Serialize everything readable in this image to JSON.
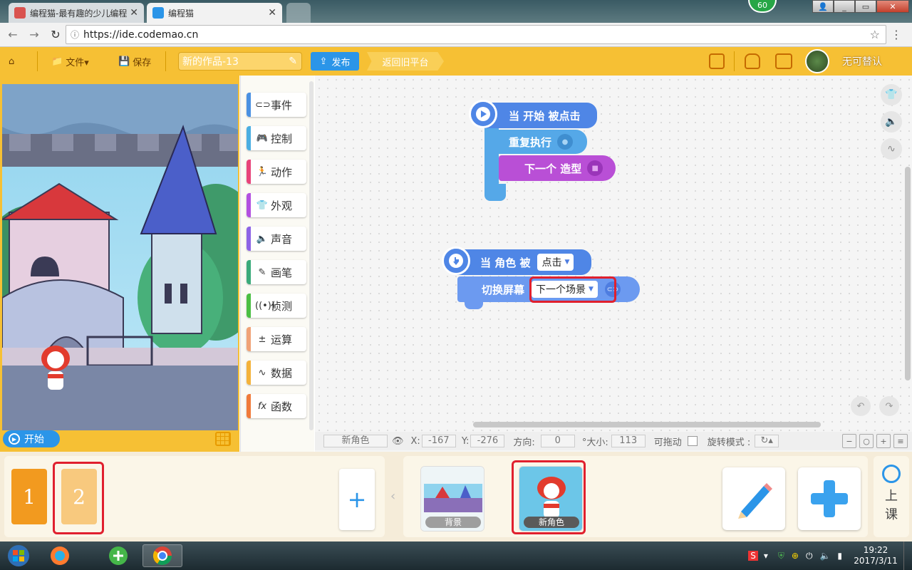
{
  "browser": {
    "tabs": [
      {
        "title": "编程猫-最有趣的少儿编程",
        "icon_color": "#d9534f"
      },
      {
        "title": "编程猫",
        "icon_color": "#2b95e8"
      },
      {
        "title": "",
        "icon_color": "#9fb0b5"
      }
    ],
    "url": "https://ide.codemao.cn",
    "badge": "60"
  },
  "toolbar": {
    "file_label": "文件▾",
    "save_label": "保存",
    "project_title": "新的作品-13",
    "publish_label": "发布",
    "old_platform_label": "返回旧平台",
    "username": "无可替认"
  },
  "stage": {
    "start_label": "开始"
  },
  "categories": [
    {
      "label": "事件",
      "color": "#4a90e2",
      "icon": "toggle-icon"
    },
    {
      "label": "控制",
      "color": "#4aaee2",
      "icon": "gamepad-icon"
    },
    {
      "label": "动作",
      "color": "#e8437a",
      "icon": "running-icon"
    },
    {
      "label": "外观",
      "color": "#b24fe0",
      "icon": "shirt-icon"
    },
    {
      "label": "声音",
      "color": "#8c63e6",
      "icon": "speaker-icon"
    },
    {
      "label": "画笔",
      "color": "#3aaa7a",
      "icon": "pen-icon"
    },
    {
      "label": "侦测",
      "color": "#4bbf43",
      "icon": "sensor-icon"
    },
    {
      "label": "运算",
      "color": "#f0a277",
      "icon": "calc-icon"
    },
    {
      "label": "数据",
      "color": "#f4b23a",
      "icon": "chart-icon"
    },
    {
      "label": "函数",
      "color": "#f07a3a",
      "icon": "fx-icon"
    }
  ],
  "blocks": {
    "when_start": "当 开始 被点击",
    "repeat": "重复执行",
    "next_costume": "下一个 造型",
    "when_sprite": "当 角色 被",
    "when_sprite_option": "点击",
    "switch_screen": "切换屏幕",
    "switch_screen_option": "下一个场景"
  },
  "status": {
    "sprite_name": "新角色",
    "x_label": "X:",
    "x": "-167",
    "y_label": "Y:",
    "y": "-276",
    "dir_label": "方向:",
    "dir": "0",
    "size_label": "°大小:",
    "size": "113",
    "draggable_label": "可拖动",
    "rotation_label": "旋转模式 :"
  },
  "scenes": [
    {
      "label": "1",
      "color": "#f29a1f"
    },
    {
      "label": "2",
      "color": "#f8c97e"
    }
  ],
  "sprites": [
    {
      "label": "背景"
    },
    {
      "label": "新角色"
    }
  ],
  "lesson": {
    "line1": "上",
    "line2": "课"
  },
  "taskbar": {
    "time": "19:22",
    "date": "2017/3/11"
  }
}
